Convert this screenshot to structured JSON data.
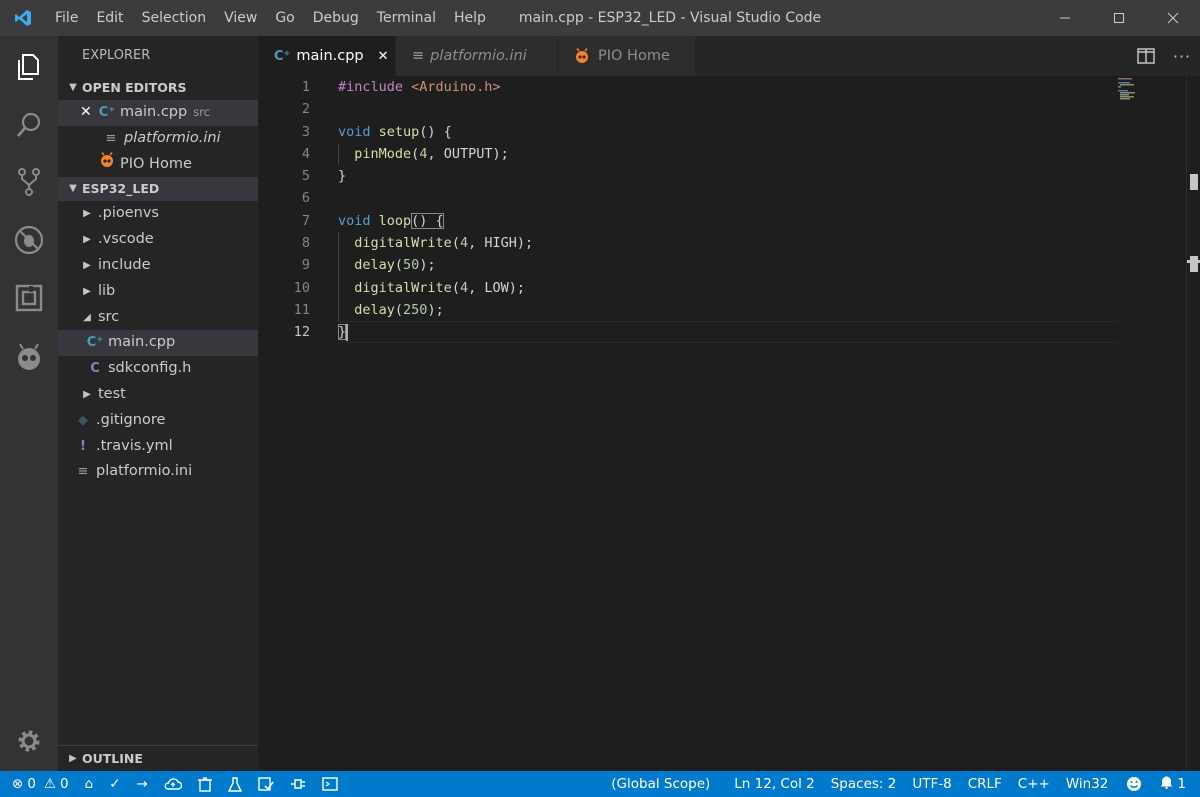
{
  "window": {
    "title": "main.cpp - ESP32_LED - Visual Studio Code"
  },
  "menu": [
    "File",
    "Edit",
    "Selection",
    "View",
    "Go",
    "Debug",
    "Terminal",
    "Help"
  ],
  "sidebar": {
    "title": "EXPLORER",
    "open_editors_label": "OPEN EDITORS",
    "open_editors": [
      {
        "name": "main.cpp",
        "sub": "src"
      },
      {
        "name": "platformio.ini"
      },
      {
        "name": "PIO Home"
      }
    ],
    "project_label": "ESP32_LED",
    "tree": [
      {
        "name": ".pioenvs"
      },
      {
        "name": ".vscode"
      },
      {
        "name": "include"
      },
      {
        "name": "lib"
      },
      {
        "name": "src"
      },
      {
        "name": "main.cpp"
      },
      {
        "name": "sdkconfig.h"
      },
      {
        "name": "test"
      },
      {
        "name": ".gitignore"
      },
      {
        "name": ".travis.yml"
      },
      {
        "name": "platformio.ini"
      }
    ],
    "outline_label": "OUTLINE"
  },
  "tabs": [
    {
      "label": "main.cpp"
    },
    {
      "label": "platformio.ini"
    },
    {
      "label": "PIO Home"
    }
  ],
  "editor": {
    "line_numbers": [
      "1",
      "2",
      "3",
      "4",
      "5",
      "6",
      "7",
      "8",
      "9",
      "10",
      "11",
      "12"
    ],
    "code": [
      [
        "#include ",
        "<Arduino.h>"
      ],
      [],
      [
        "void",
        " ",
        "setup",
        "() {"
      ],
      [
        "  ",
        "pinMode",
        "(",
        "4",
        ", OUTPUT);"
      ],
      [
        "}"
      ],
      [],
      [
        "void",
        " ",
        "loop",
        "() {"
      ],
      [
        "  ",
        "digitalWrite",
        "(",
        "4",
        ", HIGH);"
      ],
      [
        "  ",
        "delay",
        "(",
        "50",
        ");"
      ],
      [
        "  ",
        "digitalWrite",
        "(",
        "4",
        ", LOW);"
      ],
      [
        "  ",
        "delay",
        "(",
        "250",
        ");"
      ],
      [
        "}"
      ]
    ]
  },
  "status": {
    "errors": "0",
    "warnings": "0",
    "scope": "(Global Scope)",
    "position": "Ln 12, Col 2",
    "spaces": "Spaces: 2",
    "encoding": "UTF-8",
    "eol": "CRLF",
    "language": "C++",
    "platform": "Win32",
    "notifications": "1"
  },
  "colors": {
    "accent": "#007acc",
    "keyword": "#569cd6",
    "preprocessor": "#c586c0",
    "string": "#ce9178",
    "function": "#dcdcaa",
    "number": "#b5cea8",
    "pio_orange": "#f5822a",
    "cpp_icon": "#519aba",
    "header_icon": "#a074c4",
    "yml_icon": "#a074c4"
  }
}
